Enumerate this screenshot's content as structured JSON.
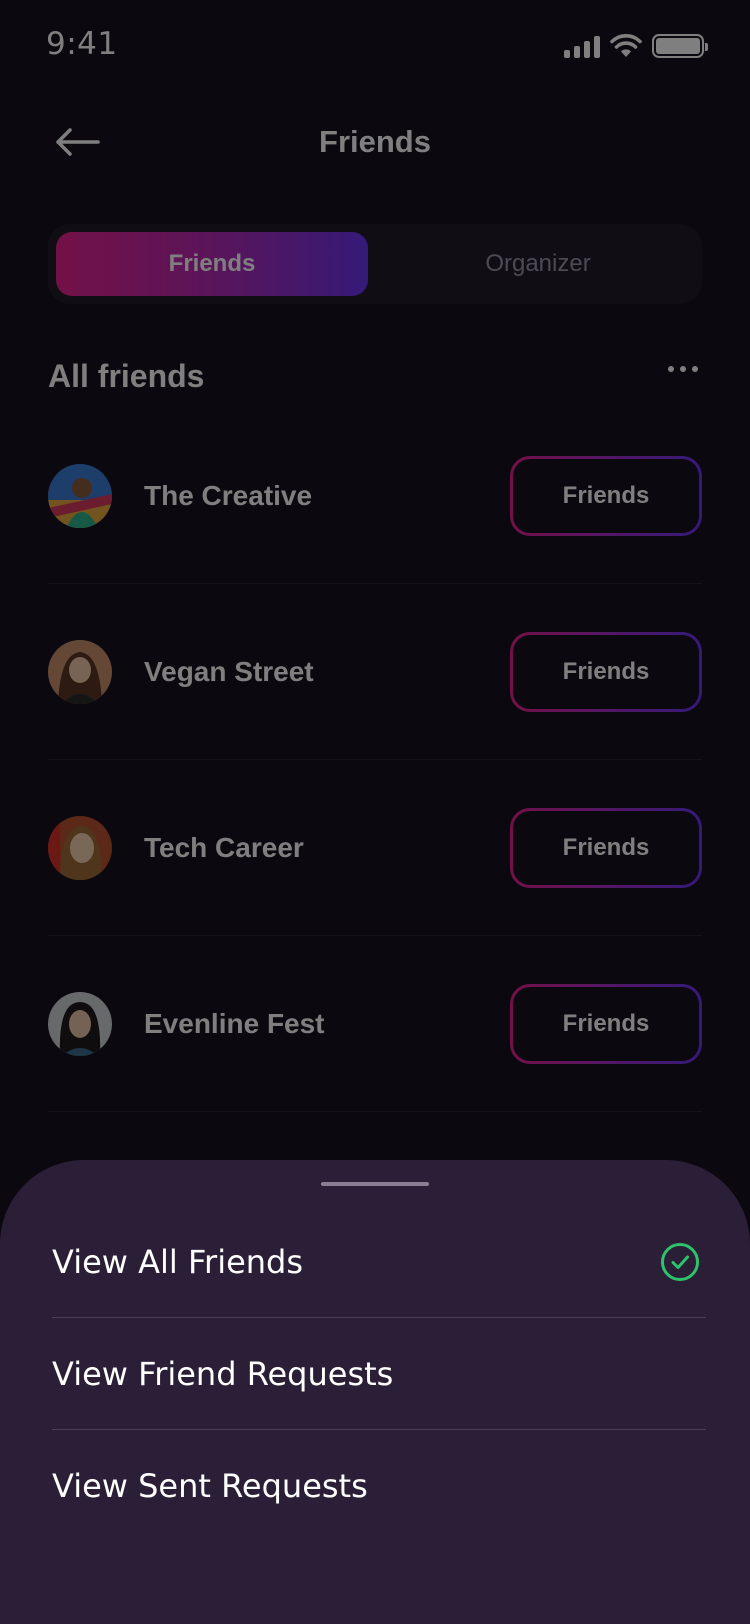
{
  "status_bar": {
    "time": "9:41"
  },
  "header": {
    "title": "Friends"
  },
  "tabs": [
    {
      "label": "Friends",
      "active": true
    },
    {
      "label": "Organizer",
      "active": false
    }
  ],
  "section": {
    "title": "All friends"
  },
  "friends": [
    {
      "name": "The Creative",
      "button_label": "Friends"
    },
    {
      "name": "Vegan Street",
      "button_label": "Friends"
    },
    {
      "name": "Tech Career",
      "button_label": "Friends"
    },
    {
      "name": "Evenline Fest",
      "button_label": "Friends"
    }
  ],
  "sheet": {
    "options": [
      {
        "label": "View All Friends",
        "selected": true
      },
      {
        "label": "View Friend Requests",
        "selected": false
      },
      {
        "label": "View Sent Requests",
        "selected": false
      }
    ]
  },
  "colors": {
    "accent_start": "#e6228e",
    "accent_end": "#6a34f0",
    "check_green": "#2ec36b",
    "sheet_bg": "#2b1f38"
  }
}
